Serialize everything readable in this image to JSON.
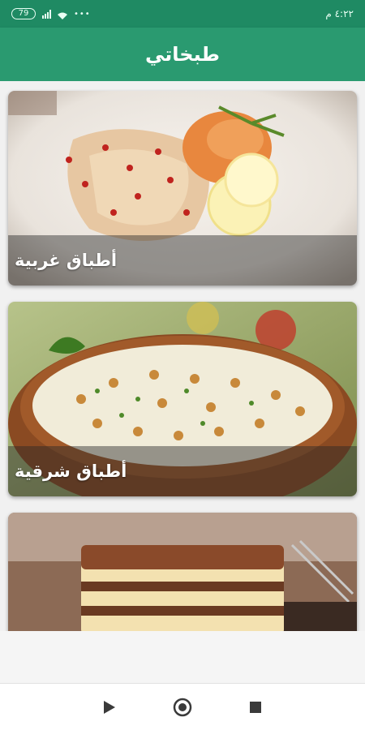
{
  "status_bar": {
    "time": "٤:٢٢ م",
    "battery": "79",
    "dots": "•••"
  },
  "app_bar": {
    "title": "طبخاتي"
  },
  "categories": [
    {
      "label": "أطباق غربية",
      "image": "western-dish-photo"
    },
    {
      "label": "أطباق شرقية",
      "image": "eastern-dish-photo"
    },
    {
      "label": "",
      "image": "dessert-photo"
    }
  ],
  "nav_bar": {
    "back_icon": "play-triangle-icon",
    "home_icon": "circle-home-icon",
    "recents_icon": "square-recents-icon"
  },
  "colors": {
    "status_bar": "#1f8a63",
    "app_bar": "#2a9a70",
    "background": "#f1f1f1"
  }
}
